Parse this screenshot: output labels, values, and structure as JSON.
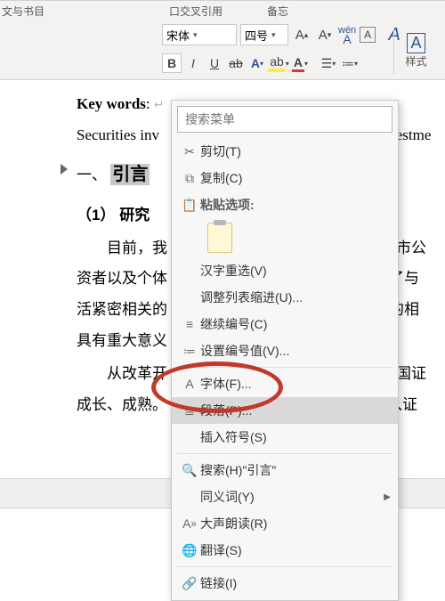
{
  "ribbon": {
    "crumb_left": "文与书目",
    "crumb_mid1": "口交叉引用",
    "crumb_mid2": "备忘",
    "font_name": "宋体",
    "font_size": "四号",
    "style_label": "样式",
    "bold": "B",
    "italic": "I",
    "underline": "U"
  },
  "doc": {
    "keywords_label": "Key words",
    "keywords_colon": ":",
    "line2_a": "Securities inv",
    "line2_b": "ivestme",
    "h1_arrow": "▾",
    "h1_num": "一、",
    "h1_title": "引言",
    "h2_num": "（1）",
    "h2_title": "研究",
    "p1_1": "目前，我",
    "p1_2": "上市公",
    "p2_1": "资者以及个体",
    "p2_2": "为了与",
    "p3_1": "活紧密相关的",
    "p3_2": "学的相",
    "p4_1": "具有重大意义",
    "p5_1": "从改革开",
    "p5_2": "我国证",
    "p6_1": "成长、成熟。",
    "p6_2": "介入证"
  },
  "menu": {
    "search_placeholder": "搜索菜单",
    "cut": "剪切(T)",
    "copy": "复制(C)",
    "paste_heading": "粘贴选项:",
    "hanzi": "汉字重选(V)",
    "adjust": "调整列表缩进(U)...",
    "continue_num": "继续编号(C)",
    "set_num": "设置编号值(V)...",
    "font": "字体(F)...",
    "paragraph": "段落(P)...",
    "insert_sym": "插入符号(S)",
    "search_h": "搜索(H)\"引言\"",
    "synonym": "同义词(Y)",
    "read_aloud": "大声朗读(R)",
    "translate": "翻译(S)",
    "link": "链接(I)"
  }
}
